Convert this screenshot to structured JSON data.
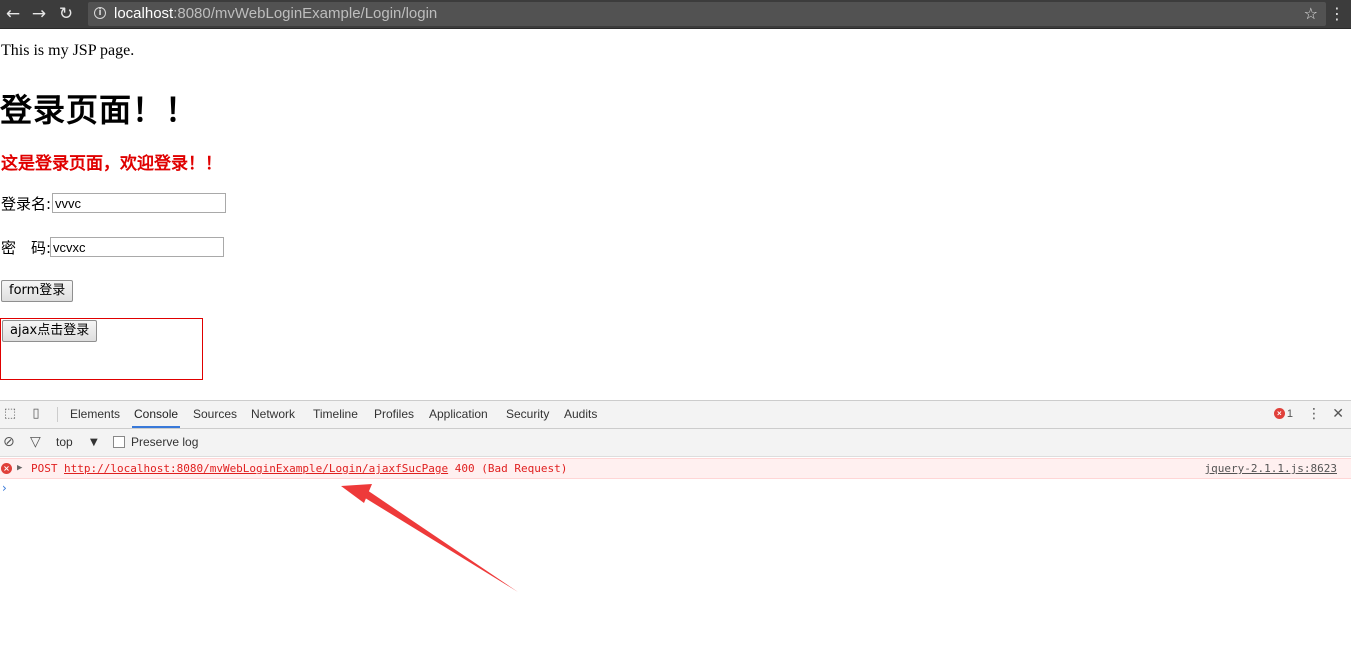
{
  "browser": {
    "url_host": "localhost",
    "url_rest": ":8080/mvWebLoginExample/Login/login",
    "back_icon": "←",
    "forward_icon": "→",
    "reload_icon": "↻",
    "info_icon": "i",
    "star_icon": "☆",
    "menu_icon": "⋮"
  },
  "page": {
    "jsp_text": "This is my JSP page.",
    "heading": "登录页面！！",
    "subheading": "这是登录页面，欢迎登录！！",
    "login_label": "登录名:",
    "login_value": "vvvc",
    "password_label": "密　码:",
    "password_value": "vcvxc",
    "form_button": "form登录",
    "ajax_button": "ajax点击登录",
    "accent_color": "#e00000"
  },
  "devtools": {
    "tabs": [
      "Elements",
      "Console",
      "Sources",
      "Network",
      "Timeline",
      "Profiles",
      "Application",
      "Security",
      "Audits"
    ],
    "active_tab": "Console",
    "error_count": "1",
    "error_icon": "×",
    "vmenu_icon": "⋮",
    "close_icon": "✕",
    "inspect_icon": "⬚",
    "device_icon": "▯",
    "clear_icon": "⊘",
    "filter_icon": "▽",
    "context": "top",
    "context_arrow": "▼",
    "preserve_log": "Preserve log",
    "console": {
      "method": "POST",
      "url": "http://localhost:8080/mvWebLoginExample/Login/ajaxfSucPage",
      "status": "400 (Bad Request)",
      "source": "jquery-2.1.1.js:8623",
      "expand_icon": "▶",
      "prompt": "›"
    }
  }
}
